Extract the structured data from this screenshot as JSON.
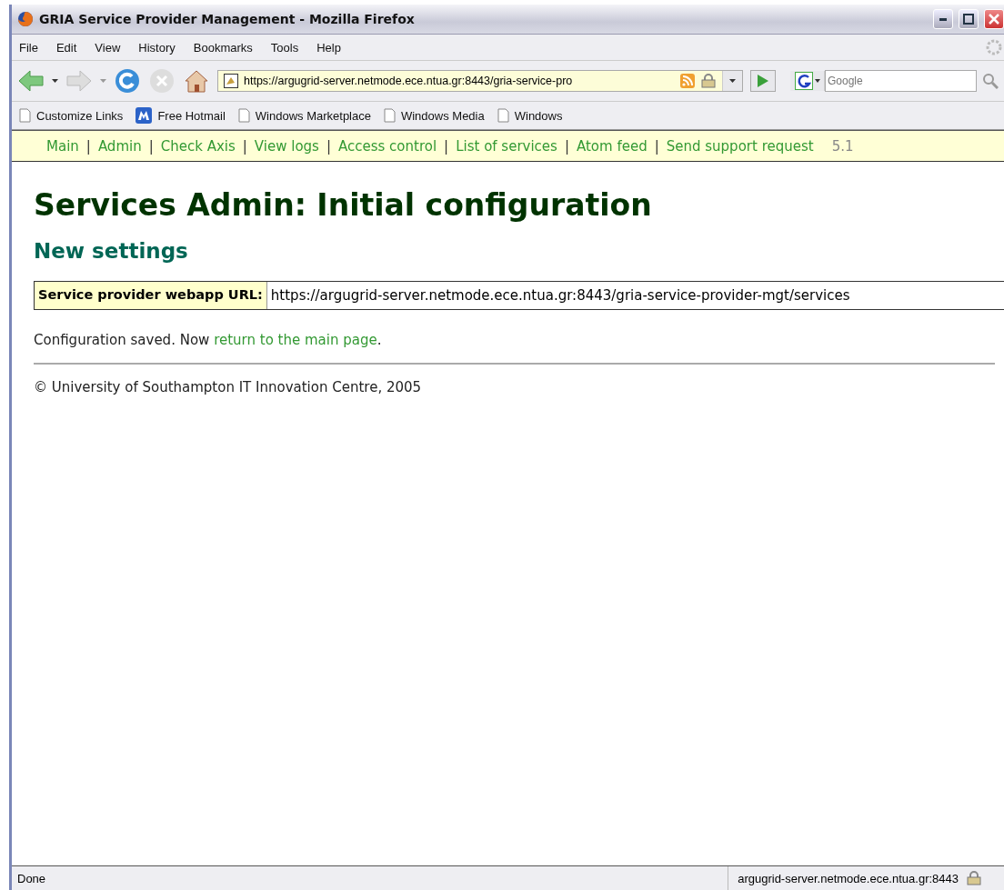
{
  "window": {
    "title": "GRIA Service Provider Management - Mozilla Firefox"
  },
  "menu": [
    "File",
    "Edit",
    "View",
    "History",
    "Bookmarks",
    "Tools",
    "Help"
  ],
  "address_bar": {
    "value": "https://argugrid-server.netmode.ece.ntua.gr:8443/gria-service-pro"
  },
  "search": {
    "placeholder": "Google"
  },
  "bookmarks": [
    {
      "label": "Customize Links",
      "kind": "page"
    },
    {
      "label": "Free Hotmail",
      "kind": "msn"
    },
    {
      "label": "Windows Marketplace",
      "kind": "page"
    },
    {
      "label": "Windows Media",
      "kind": "page"
    },
    {
      "label": "Windows",
      "kind": "page"
    }
  ],
  "site_nav": {
    "items": [
      {
        "kind": "link",
        "text": "Main"
      },
      {
        "kind": "separator",
        "text": "|"
      },
      {
        "kind": "link",
        "text": "Admin"
      },
      {
        "kind": "separator",
        "text": "|"
      },
      {
        "kind": "link",
        "text": "Check Axis"
      },
      {
        "kind": "separator",
        "text": "|"
      },
      {
        "kind": "link",
        "text": "View logs"
      },
      {
        "kind": "separator",
        "text": "|"
      },
      {
        "kind": "link",
        "text": "Access control"
      },
      {
        "kind": "separator",
        "text": "|"
      },
      {
        "kind": "link",
        "text": "List of services"
      },
      {
        "kind": "separator",
        "text": "|"
      },
      {
        "kind": "link",
        "text": "Atom feed"
      },
      {
        "kind": "separator",
        "text": "|"
      },
      {
        "kind": "link",
        "text": "Send support request"
      }
    ],
    "version": "5.1"
  },
  "page": {
    "title": "Services Admin: Initial configuration",
    "subtitle": "New settings",
    "settings": [
      {
        "label": "Service provider webapp URL:",
        "value": "https://argugrid-server.netmode.ece.ntua.gr:8443/gria-service-provider-mgt/services"
      }
    ],
    "message": "Configuration saved. Now",
    "message_link": "return to the main page",
    "message_end": ".",
    "footer": "© University of Southampton IT Innovation Centre, 2005"
  },
  "status_bar": {
    "text": "Done",
    "host": "argugrid-server.netmode.ece.ntua.gr:8443"
  }
}
